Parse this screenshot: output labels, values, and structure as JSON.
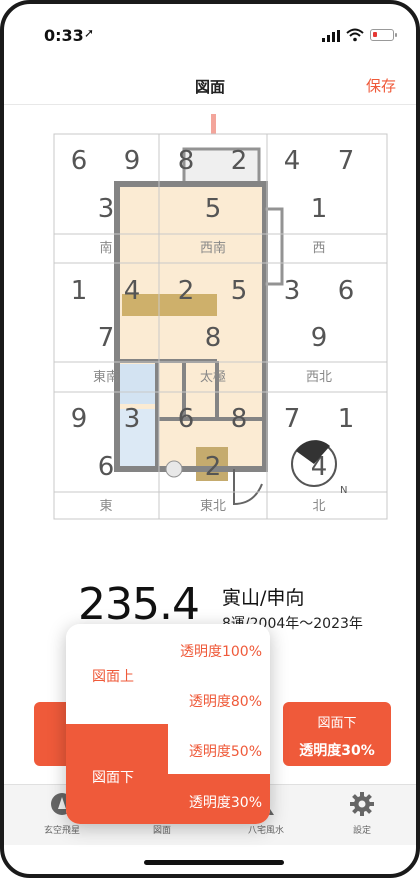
{
  "status_bar": {
    "time": "0:33",
    "location_glyph": "➚"
  },
  "nav": {
    "title": "図面",
    "save": "保存"
  },
  "grid": {
    "cells": [
      {
        "left": "6",
        "right": "9",
        "center": "3",
        "direction": "南"
      },
      {
        "left": "8",
        "right": "2",
        "center": "5",
        "direction": "西南"
      },
      {
        "left": "4",
        "right": "7",
        "center": "1",
        "direction": "西"
      },
      {
        "left": "1",
        "right": "4",
        "center": "7",
        "direction": "東南"
      },
      {
        "left": "2",
        "right": "5",
        "center": "8",
        "direction": "太極"
      },
      {
        "left": "3",
        "right": "6",
        "center": "9",
        "direction": "西北"
      },
      {
        "left": "9",
        "right": "3",
        "center": "6",
        "direction": "東"
      },
      {
        "left": "6",
        "right": "8",
        "center": "2",
        "direction": "東北"
      },
      {
        "left": "7",
        "right": "1",
        "center": "4",
        "direction": "北"
      }
    ],
    "compass_letter": "N"
  },
  "readout": {
    "degree": "235.4",
    "direction": "寅山/申向",
    "era": "8運/2004年～2023年"
  },
  "right_button": {
    "line1": "図面下",
    "line2": "透明度30%"
  },
  "popup": {
    "top_header": "図面上",
    "bottom_header": "図面下",
    "options": [
      "透明度100%",
      "透明度80%",
      "透明度50%",
      "透明度30%"
    ]
  },
  "tabs": [
    {
      "label": "玄空飛星",
      "icon": "compass-icon"
    },
    {
      "label": "図面",
      "icon": "floorplan-icon"
    },
    {
      "label": "八宅風水",
      "icon": "person-icon"
    },
    {
      "label": "設定",
      "icon": "gear-icon"
    }
  ],
  "colors": {
    "accent": "#ef5a3a"
  }
}
